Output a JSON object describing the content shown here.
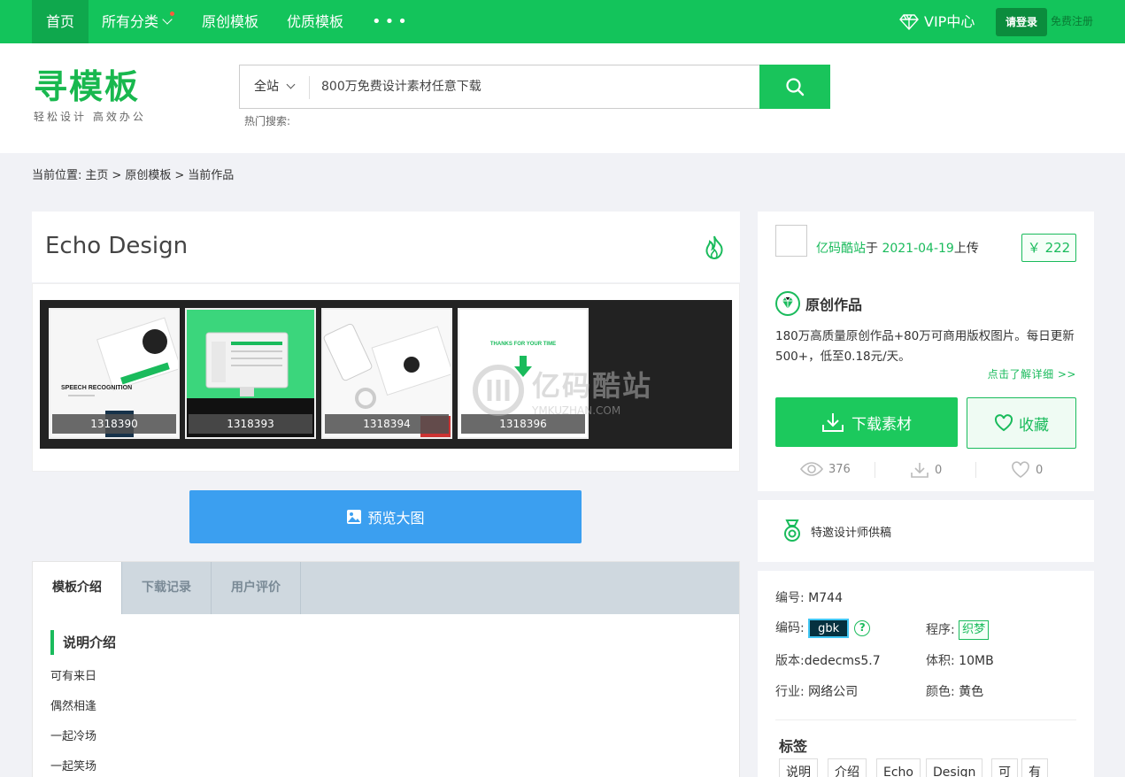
{
  "topnav": {
    "home": "首页",
    "all_categories": "所有分类",
    "original": "原创模板",
    "quality": "优质模板",
    "more": "•••",
    "vip": "VIP中心",
    "login": "请登录",
    "register": "免费注册"
  },
  "header": {
    "logo": "寻模板",
    "slogan": "轻松设计 高效办公",
    "search_scope": "全站",
    "search_placeholder": "800万免费设计素材任意下载",
    "hot_search_label": "热门搜索:"
  },
  "breadcrumb": {
    "prefix": "当前位置:",
    "items": [
      "主页",
      "原创模板",
      "当前作品"
    ],
    "sep": ">"
  },
  "item": {
    "title": "Echo Design",
    "thumbs": [
      {
        "id": "1318390",
        "label": "SPEECH RECOGNITION"
      },
      {
        "id": "1318393",
        "label": ""
      },
      {
        "id": "1318394",
        "label": ""
      },
      {
        "id": "1318396",
        "label": "THANKS FOR YOUR TIME"
      }
    ],
    "watermark_text": "亿码酷站",
    "watermark_sub": "YMKUZHAN.COM",
    "preview_label": "预览大图"
  },
  "tabs": [
    {
      "label": "模板介绍",
      "active": true
    },
    {
      "label": "下载记录",
      "active": false
    },
    {
      "label": "用户评价",
      "active": false
    }
  ],
  "description": {
    "title": "说明介绍",
    "lines": [
      "可有来日",
      "偶然相逢",
      "一起冷场",
      "一起笑场"
    ]
  },
  "sidebar": {
    "uploader_name": "亿码酷站",
    "uploader_mid": "于",
    "upload_date": "2021-04-19",
    "uploader_suffix": "上传",
    "price": "￥ 222",
    "original_title": "原创作品",
    "original_desc": "180万高质量原创作品+80万可商用版权图片。每日更新 500+，低至0.18元/天。",
    "learn_more": "点击了解详细 >>",
    "download_label": "下载素材",
    "favorite_label": "收藏",
    "stats": {
      "views": "376",
      "downloads": "0",
      "likes": "0"
    },
    "designer_label": "特邀设计师供稿"
  },
  "meta": {
    "id_label": "编号:",
    "id_value": "M744",
    "encoding_label": "编码:",
    "encoding_value": "gbk",
    "help": "?",
    "program_label": "程序:",
    "program_value": "织梦",
    "version_label": "版本:",
    "version_value": "dedecms5.7",
    "size_label": "体积:",
    "size_value": "10MB",
    "industry_label": "行业:",
    "industry_value": "网络公司",
    "color_label": "颜色:",
    "color_value": "黄色",
    "tags_title": "标签",
    "tags": [
      "说明",
      "介绍",
      "Echo",
      "Design",
      "可",
      "有"
    ]
  },
  "colors": {
    "brand_green": "#13c45b",
    "preview_blue": "#3b9ff0"
  }
}
